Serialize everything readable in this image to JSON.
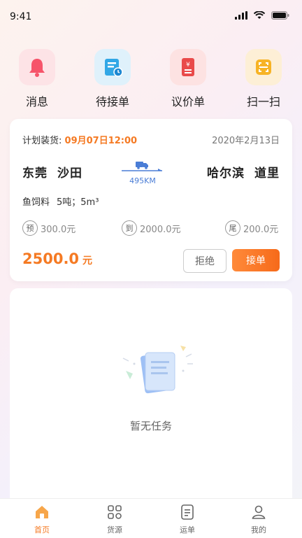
{
  "status_bar": {
    "time": "9:41"
  },
  "quick_actions": [
    {
      "label": "消息",
      "icon": "bell-icon"
    },
    {
      "label": "待接单",
      "icon": "pending-order-icon"
    },
    {
      "label": "议价单",
      "icon": "price-order-icon"
    },
    {
      "label": "扫一扫",
      "icon": "scan-icon"
    }
  ],
  "order": {
    "plan_label": "计划装货:",
    "plan_time": "09月07日12:00",
    "date": "2020年2月13日",
    "origin_city": "东莞",
    "origin_district": "沙田",
    "dest_city": "哈尔滨",
    "dest_district": "道里",
    "distance": "495KM",
    "cargo_name": "鱼饲料",
    "cargo_spec": "5吨；5m³",
    "fees": [
      {
        "tag": "预",
        "amount": "300.0元"
      },
      {
        "tag": "到",
        "amount": "2000.0元"
      },
      {
        "tag": "尾",
        "amount": "200.0元"
      }
    ],
    "total": "2500.0",
    "total_unit": "元",
    "reject_label": "拒绝",
    "accept_label": "接单"
  },
  "empty_state": {
    "text": "暂无任务"
  },
  "tabbar": [
    {
      "label": "首页",
      "icon": "home-icon",
      "active": true
    },
    {
      "label": "货源",
      "icon": "cargo-source-icon",
      "active": false
    },
    {
      "label": "运单",
      "icon": "waybill-icon",
      "active": false
    },
    {
      "label": "我的",
      "icon": "profile-icon",
      "active": false
    }
  ],
  "colors": {
    "accent": "#f57a23",
    "route_blue": "#4a7dd6"
  }
}
